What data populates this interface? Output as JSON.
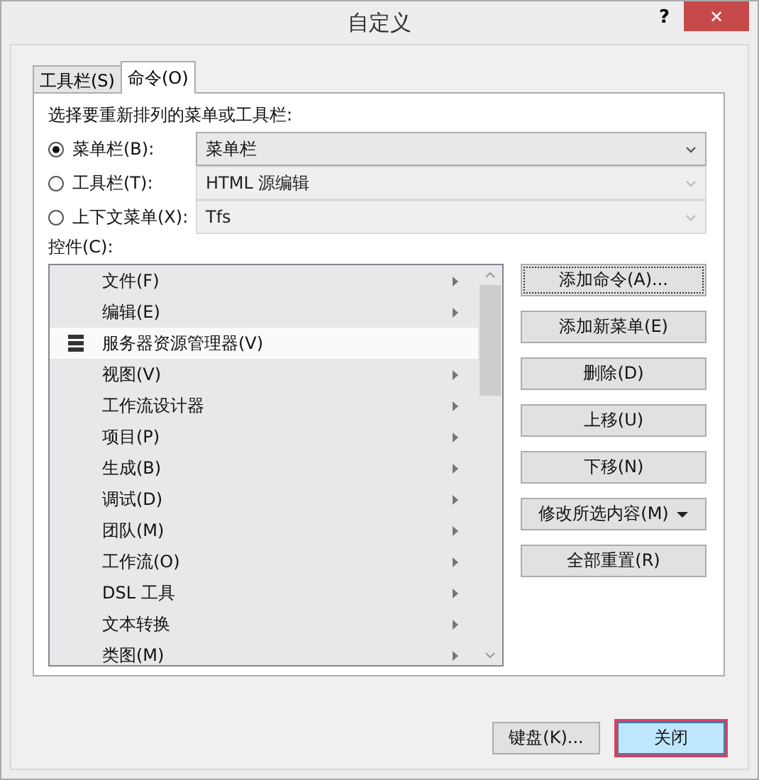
{
  "window": {
    "title": "自定义",
    "help": "?",
    "close": "✕"
  },
  "tabs": [
    {
      "label": "工具栏(S)",
      "selected": false
    },
    {
      "label": "命令(O)",
      "selected": true
    }
  ],
  "prompt": "选择要重新排列的菜单或工具栏:",
  "targets": [
    {
      "label": "菜单栏(B):",
      "selected": true,
      "value": "菜单栏",
      "disabled": false
    },
    {
      "label": "工具栏(T):",
      "selected": false,
      "value": "HTML 源编辑",
      "disabled": true
    },
    {
      "label": "上下文菜单(X):",
      "selected": false,
      "value": "Tfs",
      "disabled": true
    }
  ],
  "controls_label": "控件(C):",
  "controls": [
    {
      "label": "文件(F)",
      "kind": "submenu",
      "selected": false
    },
    {
      "label": "编辑(E)",
      "kind": "submenu",
      "selected": false
    },
    {
      "label": "服务器资源管理器(V)",
      "kind": "command",
      "selected": true
    },
    {
      "label": "视图(V)",
      "kind": "submenu",
      "selected": false
    },
    {
      "label": "工作流设计器",
      "kind": "submenu",
      "selected": false
    },
    {
      "label": "项目(P)",
      "kind": "submenu",
      "selected": false
    },
    {
      "label": "生成(B)",
      "kind": "submenu",
      "selected": false
    },
    {
      "label": "调试(D)",
      "kind": "submenu",
      "selected": false
    },
    {
      "label": "团队(M)",
      "kind": "submenu",
      "selected": false
    },
    {
      "label": "工作流(O)",
      "kind": "submenu",
      "selected": false
    },
    {
      "label": "DSL 工具",
      "kind": "submenu",
      "selected": false
    },
    {
      "label": "文本转换",
      "kind": "submenu",
      "selected": false
    },
    {
      "label": "类图(M)",
      "kind": "submenu",
      "selected": false
    }
  ],
  "actions": [
    {
      "label": "添加命令(A)...",
      "focused": true,
      "dropdown": false
    },
    {
      "label": "添加新菜单(E)",
      "focused": false,
      "dropdown": false
    },
    {
      "label": "删除(D)",
      "focused": false,
      "dropdown": false
    },
    {
      "label": "上移(U)",
      "focused": false,
      "dropdown": false
    },
    {
      "label": "下移(N)",
      "focused": false,
      "dropdown": false
    },
    {
      "label": "修改所选内容(M)",
      "focused": false,
      "dropdown": true
    },
    {
      "label": "全部重置(R)",
      "focused": false,
      "dropdown": false
    }
  ],
  "footer": [
    {
      "label": "键盘(K)...",
      "default": false,
      "highlighted": false
    },
    {
      "label": "关闭",
      "default": true,
      "highlighted": true
    }
  ]
}
